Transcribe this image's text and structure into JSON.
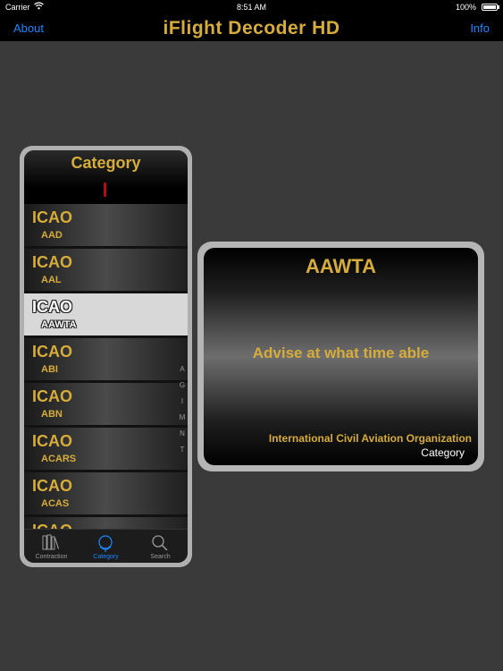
{
  "status": {
    "carrier": "Carrier",
    "time": "8:51 AM",
    "battery": "100%"
  },
  "nav": {
    "left": "About",
    "title": "iFlight Decoder HD",
    "right": "Info"
  },
  "category_header": "Category",
  "list": [
    {
      "category": "ICAO",
      "code": "AAD"
    },
    {
      "category": "ICAO",
      "code": "AAL"
    },
    {
      "category": "ICAO",
      "code": "AAWTA"
    },
    {
      "category": "ICAO",
      "code": "ABI"
    },
    {
      "category": "ICAO",
      "code": "ABN"
    },
    {
      "category": "ICAO",
      "code": "ACARS"
    },
    {
      "category": "ICAO",
      "code": "ACAS"
    },
    {
      "category": "ICAO",
      "code": ""
    }
  ],
  "index_letters": [
    "A",
    "G",
    "I",
    "M",
    "N",
    "T"
  ],
  "tabs": [
    {
      "label": "Contraction",
      "icon": "books-icon"
    },
    {
      "label": "Category",
      "icon": "globe-icon"
    },
    {
      "label": "Search",
      "icon": "search-icon"
    }
  ],
  "detail": {
    "code": "AAWTA",
    "meaning": "Advise at what time able",
    "organization": "International Civil Aviation Organization",
    "type": "Category"
  },
  "colors": {
    "accent": "#d6ac3b",
    "link": "#1b87ff",
    "background": "#3a3a3a"
  }
}
